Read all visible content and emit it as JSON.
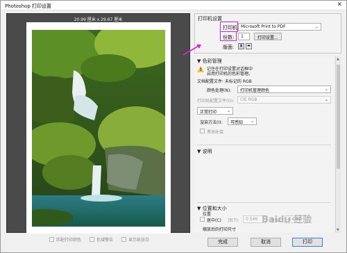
{
  "window": {
    "title": "Photoshop 打印设置",
    "close": "✕"
  },
  "preview": {
    "size_label": "20.99 厘米 x 29.67 厘米",
    "checkboxes": [
      "匹配打印颜色",
      "色域警告",
      "显示纸张白"
    ]
  },
  "printer_settings": {
    "title": "打印机设置",
    "printer_label": "打印机:",
    "printer_value": "Microsoft Print to PDF",
    "copies_label": "份数:",
    "copies_value": "1",
    "print_settings_button": "打印设置...",
    "layout_label": "版面:"
  },
  "color_management": {
    "title": "色彩管理",
    "warning_line1": "记住在打印设置对话框中",
    "warning_line2": "启用打印机的色彩管理。",
    "doc_profile": "文档配置文件: 未标记的 RGB",
    "color_handling_label": "颜色处理(N):",
    "color_handling_value": "打印机管理颜色",
    "printer_profile_label": "打印机配置文件(O):",
    "printer_profile_value": "CIE RGB",
    "normal_print": "正常打印",
    "render_intent_label": "渲染方法(I):",
    "render_intent_value": "可感知",
    "bpc_label": "黑场补偿"
  },
  "description": {
    "title": "说明"
  },
  "position_size": {
    "title": "位置和大小",
    "position_label": "位置",
    "center_label": "居中(C)",
    "top_label": "顶(T):",
    "top_value": "0.546",
    "left_label": "左(L):",
    "left_value": "-14.99",
    "scaled_label": "缩放后的打印尺寸"
  },
  "footer": {
    "done": "完成",
    "cancel": "取消",
    "print": "打印"
  },
  "watermark": "Baidu 经验",
  "colors": {
    "highlight": "#e01ee0",
    "arrow": "#e01ee0",
    "preview_bg": "#4a4a4a"
  }
}
